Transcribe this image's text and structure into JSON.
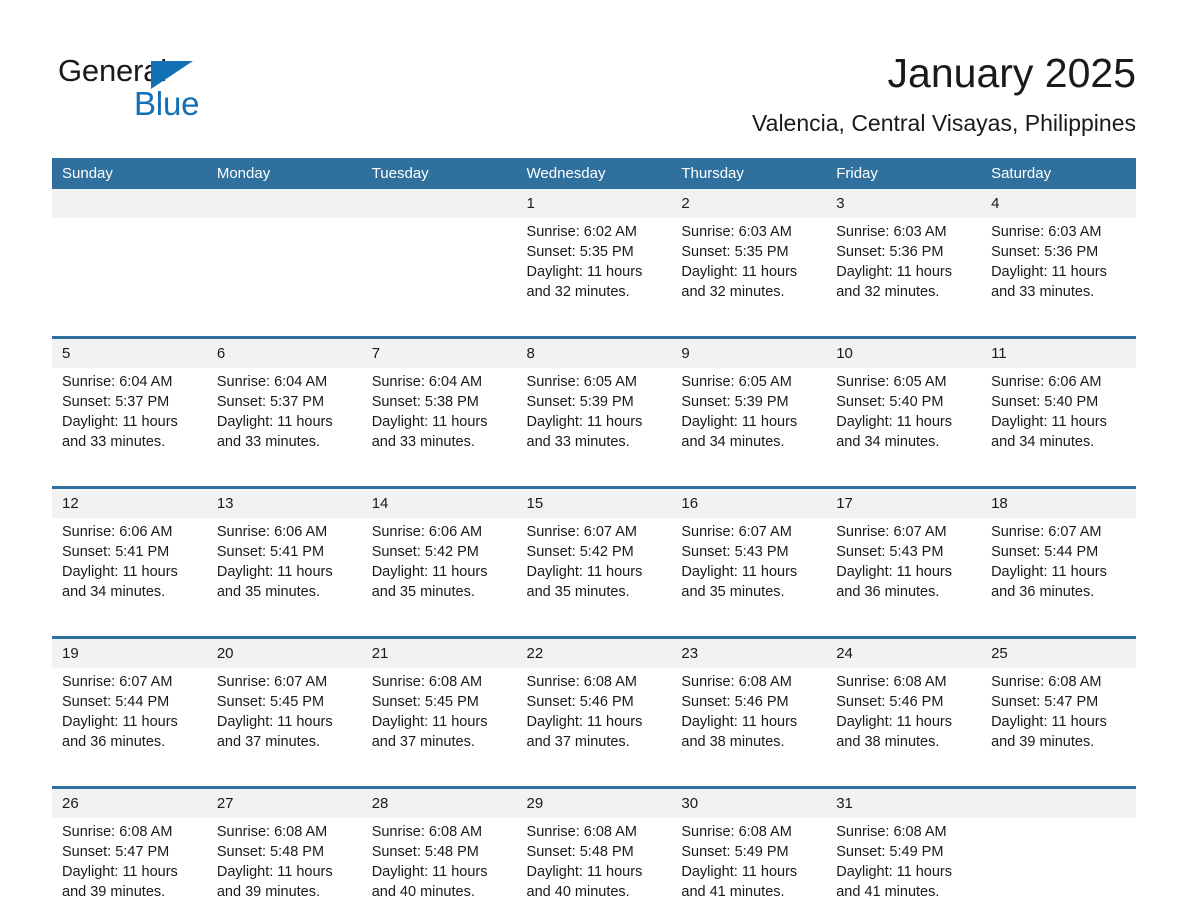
{
  "brand": {
    "name_part1": "General",
    "name_part2": "Blue",
    "accent_color": "#1470b5"
  },
  "header": {
    "month_title": "January 2025",
    "location": "Valencia, Central Visayas, Philippines"
  },
  "calendar": {
    "header_bg": "#30709f",
    "daynum_bg": "#f2f2f2",
    "weekdays": [
      "Sunday",
      "Monday",
      "Tuesday",
      "Wednesday",
      "Thursday",
      "Friday",
      "Saturday"
    ],
    "weeks": [
      [
        {
          "day": "",
          "sunrise": "",
          "sunset": "",
          "daylight": "",
          "empty": true
        },
        {
          "day": "",
          "sunrise": "",
          "sunset": "",
          "daylight": "",
          "empty": true
        },
        {
          "day": "",
          "sunrise": "",
          "sunset": "",
          "daylight": "",
          "empty": true
        },
        {
          "day": "1",
          "sunrise": "Sunrise: 6:02 AM",
          "sunset": "Sunset: 5:35 PM",
          "daylight": "Daylight: 11 hours and 32 minutes."
        },
        {
          "day": "2",
          "sunrise": "Sunrise: 6:03 AM",
          "sunset": "Sunset: 5:35 PM",
          "daylight": "Daylight: 11 hours and 32 minutes."
        },
        {
          "day": "3",
          "sunrise": "Sunrise: 6:03 AM",
          "sunset": "Sunset: 5:36 PM",
          "daylight": "Daylight: 11 hours and 32 minutes."
        },
        {
          "day": "4",
          "sunrise": "Sunrise: 6:03 AM",
          "sunset": "Sunset: 5:36 PM",
          "daylight": "Daylight: 11 hours and 33 minutes."
        }
      ],
      [
        {
          "day": "5",
          "sunrise": "Sunrise: 6:04 AM",
          "sunset": "Sunset: 5:37 PM",
          "daylight": "Daylight: 11 hours and 33 minutes."
        },
        {
          "day": "6",
          "sunrise": "Sunrise: 6:04 AM",
          "sunset": "Sunset: 5:37 PM",
          "daylight": "Daylight: 11 hours and 33 minutes."
        },
        {
          "day": "7",
          "sunrise": "Sunrise: 6:04 AM",
          "sunset": "Sunset: 5:38 PM",
          "daylight": "Daylight: 11 hours and 33 minutes."
        },
        {
          "day": "8",
          "sunrise": "Sunrise: 6:05 AM",
          "sunset": "Sunset: 5:39 PM",
          "daylight": "Daylight: 11 hours and 33 minutes."
        },
        {
          "day": "9",
          "sunrise": "Sunrise: 6:05 AM",
          "sunset": "Sunset: 5:39 PM",
          "daylight": "Daylight: 11 hours and 34 minutes."
        },
        {
          "day": "10",
          "sunrise": "Sunrise: 6:05 AM",
          "sunset": "Sunset: 5:40 PM",
          "daylight": "Daylight: 11 hours and 34 minutes."
        },
        {
          "day": "11",
          "sunrise": "Sunrise: 6:06 AM",
          "sunset": "Sunset: 5:40 PM",
          "daylight": "Daylight: 11 hours and 34 minutes."
        }
      ],
      [
        {
          "day": "12",
          "sunrise": "Sunrise: 6:06 AM",
          "sunset": "Sunset: 5:41 PM",
          "daylight": "Daylight: 11 hours and 34 minutes."
        },
        {
          "day": "13",
          "sunrise": "Sunrise: 6:06 AM",
          "sunset": "Sunset: 5:41 PM",
          "daylight": "Daylight: 11 hours and 35 minutes."
        },
        {
          "day": "14",
          "sunrise": "Sunrise: 6:06 AM",
          "sunset": "Sunset: 5:42 PM",
          "daylight": "Daylight: 11 hours and 35 minutes."
        },
        {
          "day": "15",
          "sunrise": "Sunrise: 6:07 AM",
          "sunset": "Sunset: 5:42 PM",
          "daylight": "Daylight: 11 hours and 35 minutes."
        },
        {
          "day": "16",
          "sunrise": "Sunrise: 6:07 AM",
          "sunset": "Sunset: 5:43 PM",
          "daylight": "Daylight: 11 hours and 35 minutes."
        },
        {
          "day": "17",
          "sunrise": "Sunrise: 6:07 AM",
          "sunset": "Sunset: 5:43 PM",
          "daylight": "Daylight: 11 hours and 36 minutes."
        },
        {
          "day": "18",
          "sunrise": "Sunrise: 6:07 AM",
          "sunset": "Sunset: 5:44 PM",
          "daylight": "Daylight: 11 hours and 36 minutes."
        }
      ],
      [
        {
          "day": "19",
          "sunrise": "Sunrise: 6:07 AM",
          "sunset": "Sunset: 5:44 PM",
          "daylight": "Daylight: 11 hours and 36 minutes."
        },
        {
          "day": "20",
          "sunrise": "Sunrise: 6:07 AM",
          "sunset": "Sunset: 5:45 PM",
          "daylight": "Daylight: 11 hours and 37 minutes."
        },
        {
          "day": "21",
          "sunrise": "Sunrise: 6:08 AM",
          "sunset": "Sunset: 5:45 PM",
          "daylight": "Daylight: 11 hours and 37 minutes."
        },
        {
          "day": "22",
          "sunrise": "Sunrise: 6:08 AM",
          "sunset": "Sunset: 5:46 PM",
          "daylight": "Daylight: 11 hours and 37 minutes."
        },
        {
          "day": "23",
          "sunrise": "Sunrise: 6:08 AM",
          "sunset": "Sunset: 5:46 PM",
          "daylight": "Daylight: 11 hours and 38 minutes."
        },
        {
          "day": "24",
          "sunrise": "Sunrise: 6:08 AM",
          "sunset": "Sunset: 5:46 PM",
          "daylight": "Daylight: 11 hours and 38 minutes."
        },
        {
          "day": "25",
          "sunrise": "Sunrise: 6:08 AM",
          "sunset": "Sunset: 5:47 PM",
          "daylight": "Daylight: 11 hours and 39 minutes."
        }
      ],
      [
        {
          "day": "26",
          "sunrise": "Sunrise: 6:08 AM",
          "sunset": "Sunset: 5:47 PM",
          "daylight": "Daylight: 11 hours and 39 minutes."
        },
        {
          "day": "27",
          "sunrise": "Sunrise: 6:08 AM",
          "sunset": "Sunset: 5:48 PM",
          "daylight": "Daylight: 11 hours and 39 minutes."
        },
        {
          "day": "28",
          "sunrise": "Sunrise: 6:08 AM",
          "sunset": "Sunset: 5:48 PM",
          "daylight": "Daylight: 11 hours and 40 minutes."
        },
        {
          "day": "29",
          "sunrise": "Sunrise: 6:08 AM",
          "sunset": "Sunset: 5:48 PM",
          "daylight": "Daylight: 11 hours and 40 minutes."
        },
        {
          "day": "30",
          "sunrise": "Sunrise: 6:08 AM",
          "sunset": "Sunset: 5:49 PM",
          "daylight": "Daylight: 11 hours and 41 minutes."
        },
        {
          "day": "31",
          "sunrise": "Sunrise: 6:08 AM",
          "sunset": "Sunset: 5:49 PM",
          "daylight": "Daylight: 11 hours and 41 minutes."
        },
        {
          "day": "",
          "sunrise": "",
          "sunset": "",
          "daylight": "",
          "empty": true
        }
      ]
    ]
  }
}
